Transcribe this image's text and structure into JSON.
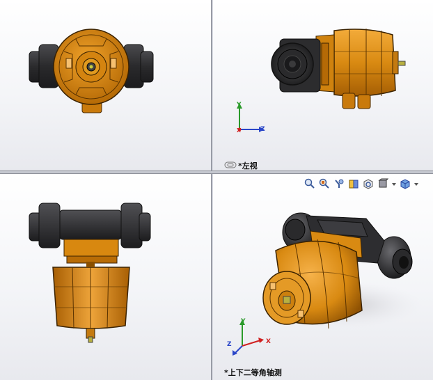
{
  "viewports": {
    "left_view": {
      "label": "*左视"
    },
    "isometric_view": {
      "label": "*上下二等角轴测"
    }
  },
  "triad": {
    "x": "X",
    "y": "Y",
    "z": "Z"
  },
  "toolbar": {
    "icons": [
      "zoom-to-fit-icon",
      "zoom-to-area-icon",
      "previous-view-icon",
      "section-view-icon",
      "view-orientation-icon",
      "display-style-icon",
      "dropdown-arrow-icon",
      "hide-show-items-icon",
      "dropdown-arrow-icon"
    ]
  },
  "colors": {
    "body_orange": "#d98a12",
    "body_dark": "#8a4f00",
    "port_black": "#2b2b2d",
    "x_axis": "#d02020",
    "y_axis": "#2a9a2a",
    "z_axis": "#2a46c8"
  }
}
